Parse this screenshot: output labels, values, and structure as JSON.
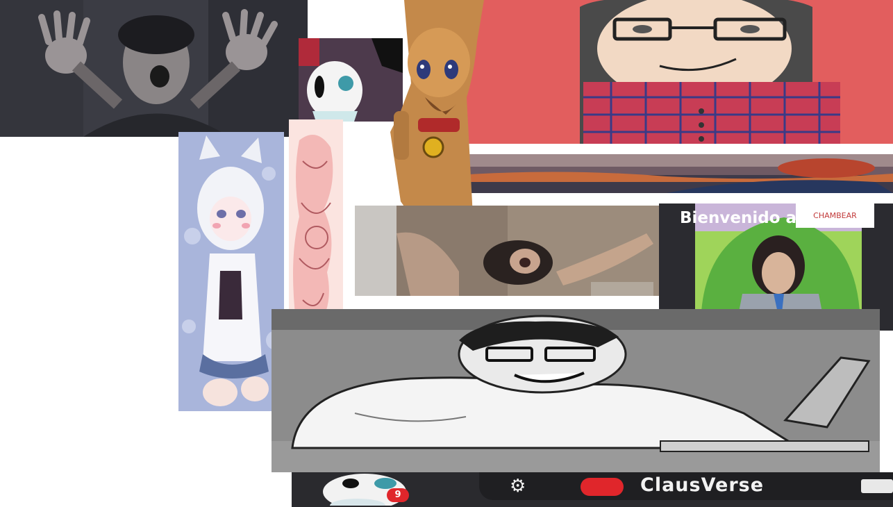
{
  "collage": {
    "welcome_text": "Bienvenido a",
    "chambear_label": "CHAMBEAR",
    "badge_count": "9",
    "username": "ClausVerse"
  },
  "colors": {
    "red_paper": "#e05a5a",
    "dark_panel": "#2b2b30",
    "badge_red": "#e0262b",
    "lavender_bg": "#a8b4dc",
    "bar_dark": "#2a2a2e"
  }
}
